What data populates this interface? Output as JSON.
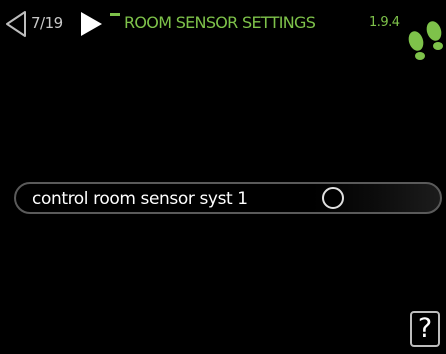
{
  "header": {
    "prev_icon": "triangle-left-outline-icon",
    "page_counter": "7/19",
    "next_icon": "triangle-right-filled-icon",
    "title": "ROOM SENSOR SETTINGS",
    "menu_number": "1.9.4",
    "status_icon": "footprints-icon"
  },
  "setting": {
    "label": "control room sensor syst 1",
    "enabled": false
  },
  "help": {
    "label": "?"
  },
  "colors": {
    "accent": "#7ec24a",
    "text": "#ffffff",
    "muted": "#c8c8c8",
    "background": "#000000"
  }
}
